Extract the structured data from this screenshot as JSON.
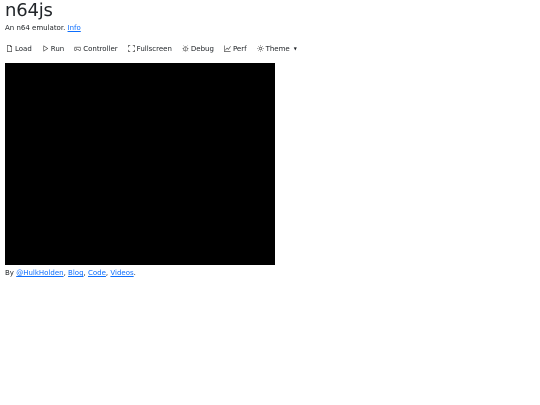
{
  "header": {
    "title": "n64js",
    "subtitle_text": "An n64 emulator.",
    "info_link": "Info"
  },
  "toolbar": {
    "load": "Load",
    "run": "Run",
    "controller": "Controller",
    "fullscreen": "Fullscreen",
    "debug": "Debug",
    "perf": "Perf",
    "theme": "Theme"
  },
  "icons": {
    "load": "file-icon",
    "run": "play-icon",
    "controller": "controller-icon",
    "fullscreen": "fullscreen-icon",
    "debug": "bug-icon",
    "perf": "chart-icon",
    "theme": "sun-icon"
  },
  "footer": {
    "by": "By",
    "author": "@HulkHolden",
    "sep1": ",",
    "blog": "Blog",
    "sep2": ",",
    "code": "Code",
    "sep3": ",",
    "videos": "Videos",
    "end": "."
  },
  "colors": {
    "link": "#0d6efd",
    "screen": "#000000"
  }
}
